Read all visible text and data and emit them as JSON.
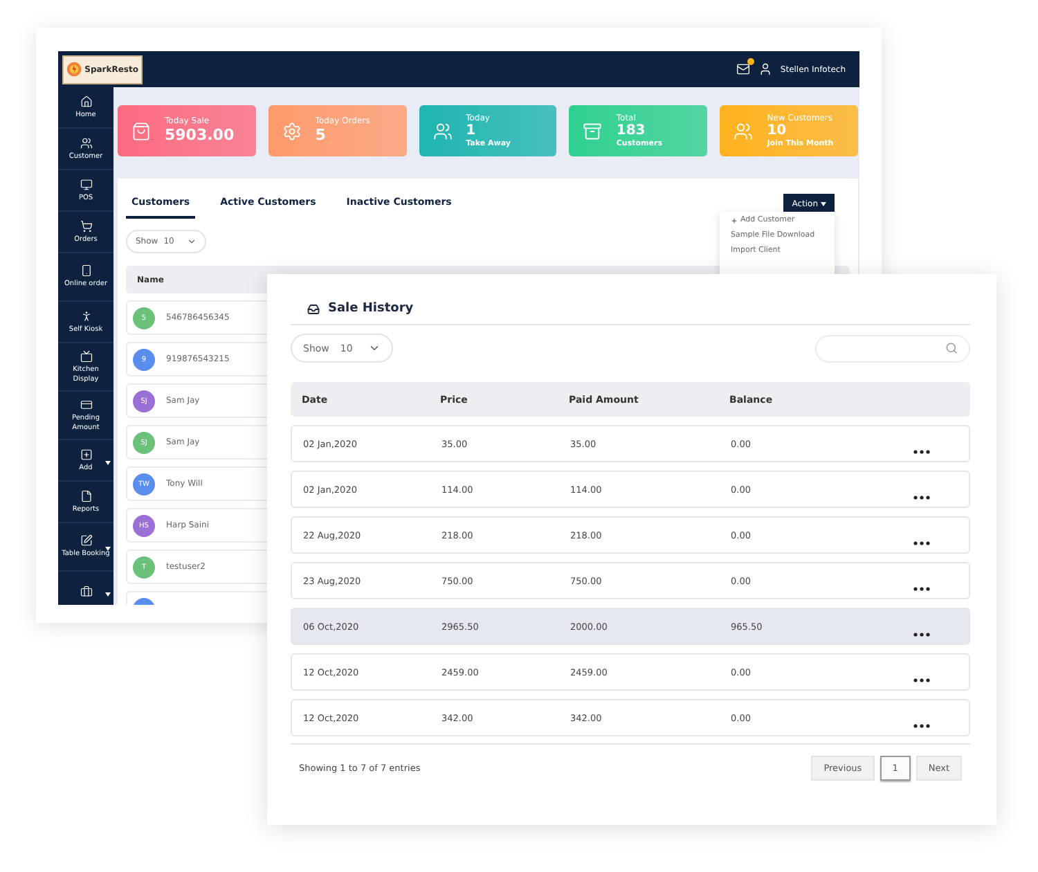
{
  "app": {
    "logo": "SparkResto",
    "user": "Stellen Infotech",
    "has_notification": true
  },
  "sidebar": {
    "items": [
      {
        "label": "Home",
        "has_submenu": false
      },
      {
        "label": "Customer",
        "has_submenu": false
      },
      {
        "label": "POS",
        "has_submenu": false
      },
      {
        "label": "Orders",
        "has_submenu": false
      },
      {
        "label": "Online order",
        "has_submenu": false
      },
      {
        "label": "Self Kiosk",
        "has_submenu": false
      },
      {
        "label": "Kitchen Display",
        "has_submenu": false
      },
      {
        "label": "Pending Amount",
        "has_submenu": false
      },
      {
        "label": "Add",
        "has_submenu": true
      },
      {
        "label": "Reports",
        "has_submenu": false
      },
      {
        "label": "Table Booking",
        "has_submenu": true
      },
      {
        "has_submenu": true
      }
    ]
  },
  "stats": [
    {
      "title": "Today Sale",
      "value": "5903.00",
      "color": "#fd6a7e"
    },
    {
      "title": "Today Orders",
      "value": "5",
      "color": "#ff9a6c"
    },
    {
      "title": "Today",
      "value": "1",
      "subtitle": "Take Away",
      "color": "#1fb5b0"
    },
    {
      "title": "Total",
      "value": "183",
      "subtitle": "Customers",
      "color": "#2fd08f"
    },
    {
      "title": "New Customers",
      "value": "10",
      "subtitle": "Join This Month",
      "color": "#ffb21e"
    }
  ],
  "tabs": [
    {
      "label": "Customers",
      "selected": true
    },
    {
      "label": "Active Customers",
      "selected": false
    },
    {
      "label": "Inactive Customers",
      "selected": false
    }
  ],
  "action": {
    "label": "Action",
    "menu": [
      "Add Customer",
      "Sample File Download",
      "Import Client"
    ]
  },
  "customers": {
    "show": {
      "label": "Show",
      "value": "10"
    },
    "columns": [
      "Name"
    ],
    "rows": [
      {
        "initials": "5",
        "name": "546786456345",
        "color": "#6cc17a"
      },
      {
        "initials": "9",
        "name": "919876543215",
        "color": "#5b8def"
      },
      {
        "initials": "SJ",
        "name": "Sam Jay",
        "color": "#9a6fd6"
      },
      {
        "initials": "SJ",
        "name": "Sam Jay",
        "color": "#6cc17a"
      },
      {
        "initials": "TW",
        "name": "Tony Will",
        "color": "#5b8def"
      },
      {
        "initials": "HS",
        "name": "Harp Saini",
        "color": "#9a6fd6"
      },
      {
        "initials": "T",
        "name": "testuser2",
        "color": "#6cc17a"
      },
      {
        "color": "#5b8def"
      }
    ]
  },
  "sale_history": {
    "title": "Sale History",
    "show": {
      "label": "Show",
      "value": "10"
    },
    "columns": [
      "Date",
      "Price",
      "Paid Amount",
      "Balance"
    ],
    "rows": [
      {
        "date": "02 Jan,2020",
        "price": "35.00",
        "paid": "35.00",
        "balance": "0.00",
        "selected": false
      },
      {
        "date": "02 Jan,2020",
        "price": "114.00",
        "paid": "114.00",
        "balance": "0.00",
        "selected": false
      },
      {
        "date": "22 Aug,2020",
        "price": "218.00",
        "paid": "218.00",
        "balance": "0.00",
        "selected": false
      },
      {
        "date": "23 Aug,2020",
        "price": "750.00",
        "paid": "750.00",
        "balance": "0.00",
        "selected": false
      },
      {
        "date": "06 Oct,2020",
        "price": "2965.50",
        "paid": "2000.00",
        "balance": "965.50",
        "selected": true
      },
      {
        "date": "12 Oct,2020",
        "price": "2459.00",
        "paid": "2459.00",
        "balance": "0.00",
        "selected": false
      },
      {
        "date": "12 Oct,2020",
        "price": "342.00",
        "paid": "342.00",
        "balance": "0.00",
        "selected": false
      }
    ],
    "footer": "Showing 1 to 7 of 7 entries",
    "pagination": {
      "previous": "Previous",
      "pages": [
        {
          "label": "1",
          "selected": true
        }
      ],
      "next": "Next"
    }
  }
}
